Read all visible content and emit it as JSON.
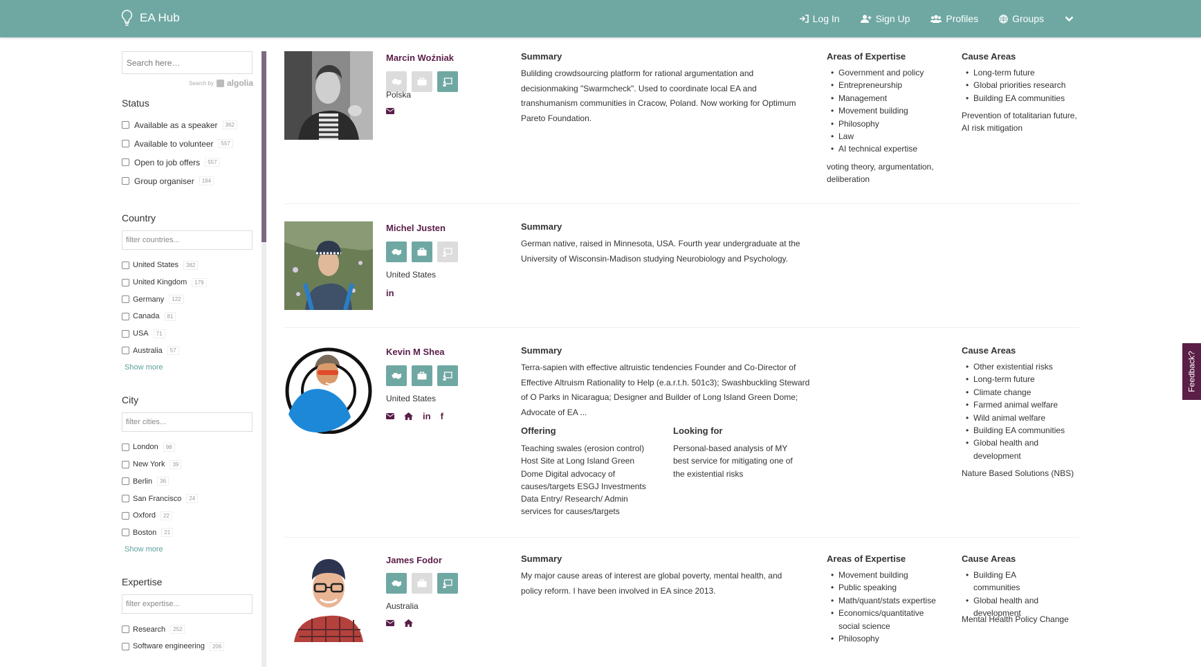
{
  "nav": {
    "brand": "EA Hub",
    "links": [
      {
        "label": "Log In",
        "icon": "login-icon"
      },
      {
        "label": "Sign Up",
        "icon": "user-plus-icon"
      },
      {
        "label": "Profiles",
        "icon": "users-icon"
      },
      {
        "label": "Groups",
        "icon": "globe-icon"
      }
    ]
  },
  "sidebar": {
    "search_placeholder": "Search here…",
    "search_by": "Search by",
    "algolia": "algolia",
    "status": {
      "title": "Status",
      "items": [
        {
          "label": "Available as a speaker",
          "count": "362"
        },
        {
          "label": "Available to volunteer",
          "count": "557"
        },
        {
          "label": "Open to job offers",
          "count": "557"
        },
        {
          "label": "Group organiser",
          "count": "194"
        }
      ]
    },
    "country": {
      "title": "Country",
      "placeholder": "filter countries...",
      "items": [
        {
          "label": "United States",
          "count": "382"
        },
        {
          "label": "United Kingdom",
          "count": "179"
        },
        {
          "label": "Germany",
          "count": "122"
        },
        {
          "label": "Canada",
          "count": "81"
        },
        {
          "label": "USA",
          "count": "71"
        },
        {
          "label": "Australia",
          "count": "57"
        }
      ],
      "show_more": "Show more"
    },
    "city": {
      "title": "City",
      "placeholder": "filter cities...",
      "items": [
        {
          "label": "London",
          "count": "98"
        },
        {
          "label": "New York",
          "count": "39"
        },
        {
          "label": "Berlin",
          "count": "36"
        },
        {
          "label": "San Francisco",
          "count": "24"
        },
        {
          "label": "Oxford",
          "count": "22"
        },
        {
          "label": "Boston",
          "count": "21"
        }
      ],
      "show_more": "Show more"
    },
    "expertise": {
      "title": "Expertise",
      "placeholder": "filter expertise...",
      "items": [
        {
          "label": "Research",
          "count": "252"
        },
        {
          "label": "Software engineering",
          "count": "206"
        }
      ]
    }
  },
  "labels": {
    "summary": "Summary",
    "areas": "Areas of Expertise",
    "causes": "Cause Areas",
    "offering": "Offering",
    "looking": "Looking for"
  },
  "profiles": [
    {
      "name": "Marcin Woźniak",
      "country": "Polska",
      "summary": "Bulilding crowdsourcing platform for rational argumentation and decisionmaking \"Swarmcheck\". Used to coordinate local EA and transhumanism communities in Cracow, Poland. Now working for Optimum Pareto Foundation.",
      "expertise": [
        "Government and policy",
        "Entrepreneurship",
        "Management",
        "Movement building",
        "Philosophy",
        "Law",
        "AI technical expertise"
      ],
      "expertise_extra": "voting theory, argumentation, deliberation",
      "causes": [
        "Long-term future",
        "Global priorities research",
        "Building EA communities"
      ],
      "causes_extra": "Prevention of totalitarian future, AI risk mitigation"
    },
    {
      "name": "Michel Justen",
      "country": "United States",
      "summary": "German native, raised in Minnesota, USA. Fourth year undergraduate at the University of Wisconsin-Madison studying Neurobiology and Psychology."
    },
    {
      "name": "Kevin M Shea",
      "country": "United States",
      "summary": "Terra-sapien with effective altruistic tendencies Founder and Co-Director of Effective Altruism Rationality to Help (e.a.r.t.h. 501c3); Swashbuckling Steward of O Parks in Nicaragua; Designer and Builder of Long Island Green Dome; Advocate of EA ...",
      "offering": "Teaching swales (erosion control) Host Site at Long Island Green Dome Digital advocacy of causes/targets ESGJ Investments Data Entry/ Research/ Admin services for causes/targets",
      "looking": "Personal-based analysis of MY best service for mitigating one of the existential risks",
      "causes": [
        "Other existential risks",
        "Long-term future",
        "Climate change",
        "Farmed animal welfare",
        "Wild animal welfare",
        "Building EA communities",
        "Global health and development"
      ],
      "causes_extra": "Nature Based Solutions (NBS)"
    },
    {
      "name": "James Fodor",
      "country": "Australia",
      "summary": "My major cause areas of interest are global poverty, mental health, and policy reform. I have been involved in EA since 2013.",
      "expertise": [
        "Movement building",
        "Public speaking",
        "Math/quant/stats expertise",
        "Economics/quantitative social science",
        "Philosophy"
      ],
      "causes": [
        "Building EA communities",
        "Global health and development"
      ],
      "causes_extra": "Mental Health Policy Change"
    }
  ],
  "feedback": "Feedback?",
  "colors": {
    "navbar": "#6fa8a3",
    "accent": "#5a1e47",
    "icon_on": "#6fa8a3",
    "icon_off": "#dcdcdc"
  }
}
